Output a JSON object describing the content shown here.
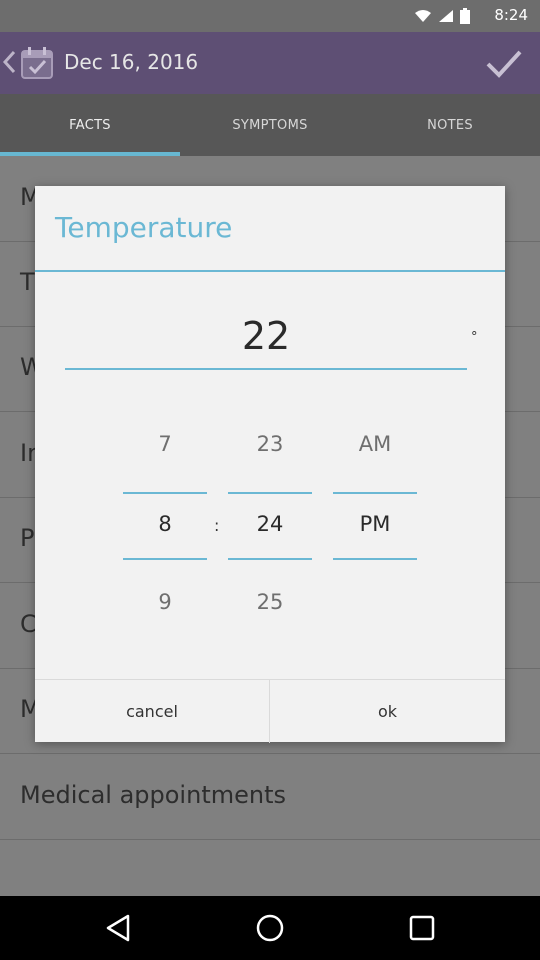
{
  "status_bar": {
    "time": "8:24"
  },
  "app_bar": {
    "date_title": "Dec 16, 2016"
  },
  "tabs": [
    {
      "label": "FACTS",
      "active": true
    },
    {
      "label": "SYMPTOMS",
      "active": false
    },
    {
      "label": "NOTES",
      "active": false
    }
  ],
  "list": {
    "items": [
      {
        "label": "M"
      },
      {
        "label": "T"
      },
      {
        "label": "W"
      },
      {
        "label": "In"
      },
      {
        "label": "P"
      },
      {
        "label": "C"
      },
      {
        "label": "M"
      },
      {
        "label": "Medical appointments"
      }
    ]
  },
  "dialog": {
    "title": "Temperature",
    "value": "22",
    "degree_symbol": "°",
    "hour_picker": {
      "prev": "7",
      "current": "8",
      "next": "9"
    },
    "separator": ":",
    "minute_picker": {
      "prev": "23",
      "current": "24",
      "next": "25"
    },
    "ampm_picker": {
      "prev": "AM",
      "current": "PM",
      "next": ""
    },
    "cancel_label": "cancel",
    "ok_label": "ok"
  },
  "colors": {
    "accent": "#6bb8d4",
    "app_bar": "#5e4f74",
    "tab_bar": "#575757",
    "dim_background": "#808080"
  },
  "icons": [
    "back-icon",
    "calendar-icon",
    "check-icon",
    "wifi-icon",
    "signal-icon",
    "battery-icon",
    "nav-back-icon",
    "nav-home-icon",
    "nav-recents-icon"
  ]
}
